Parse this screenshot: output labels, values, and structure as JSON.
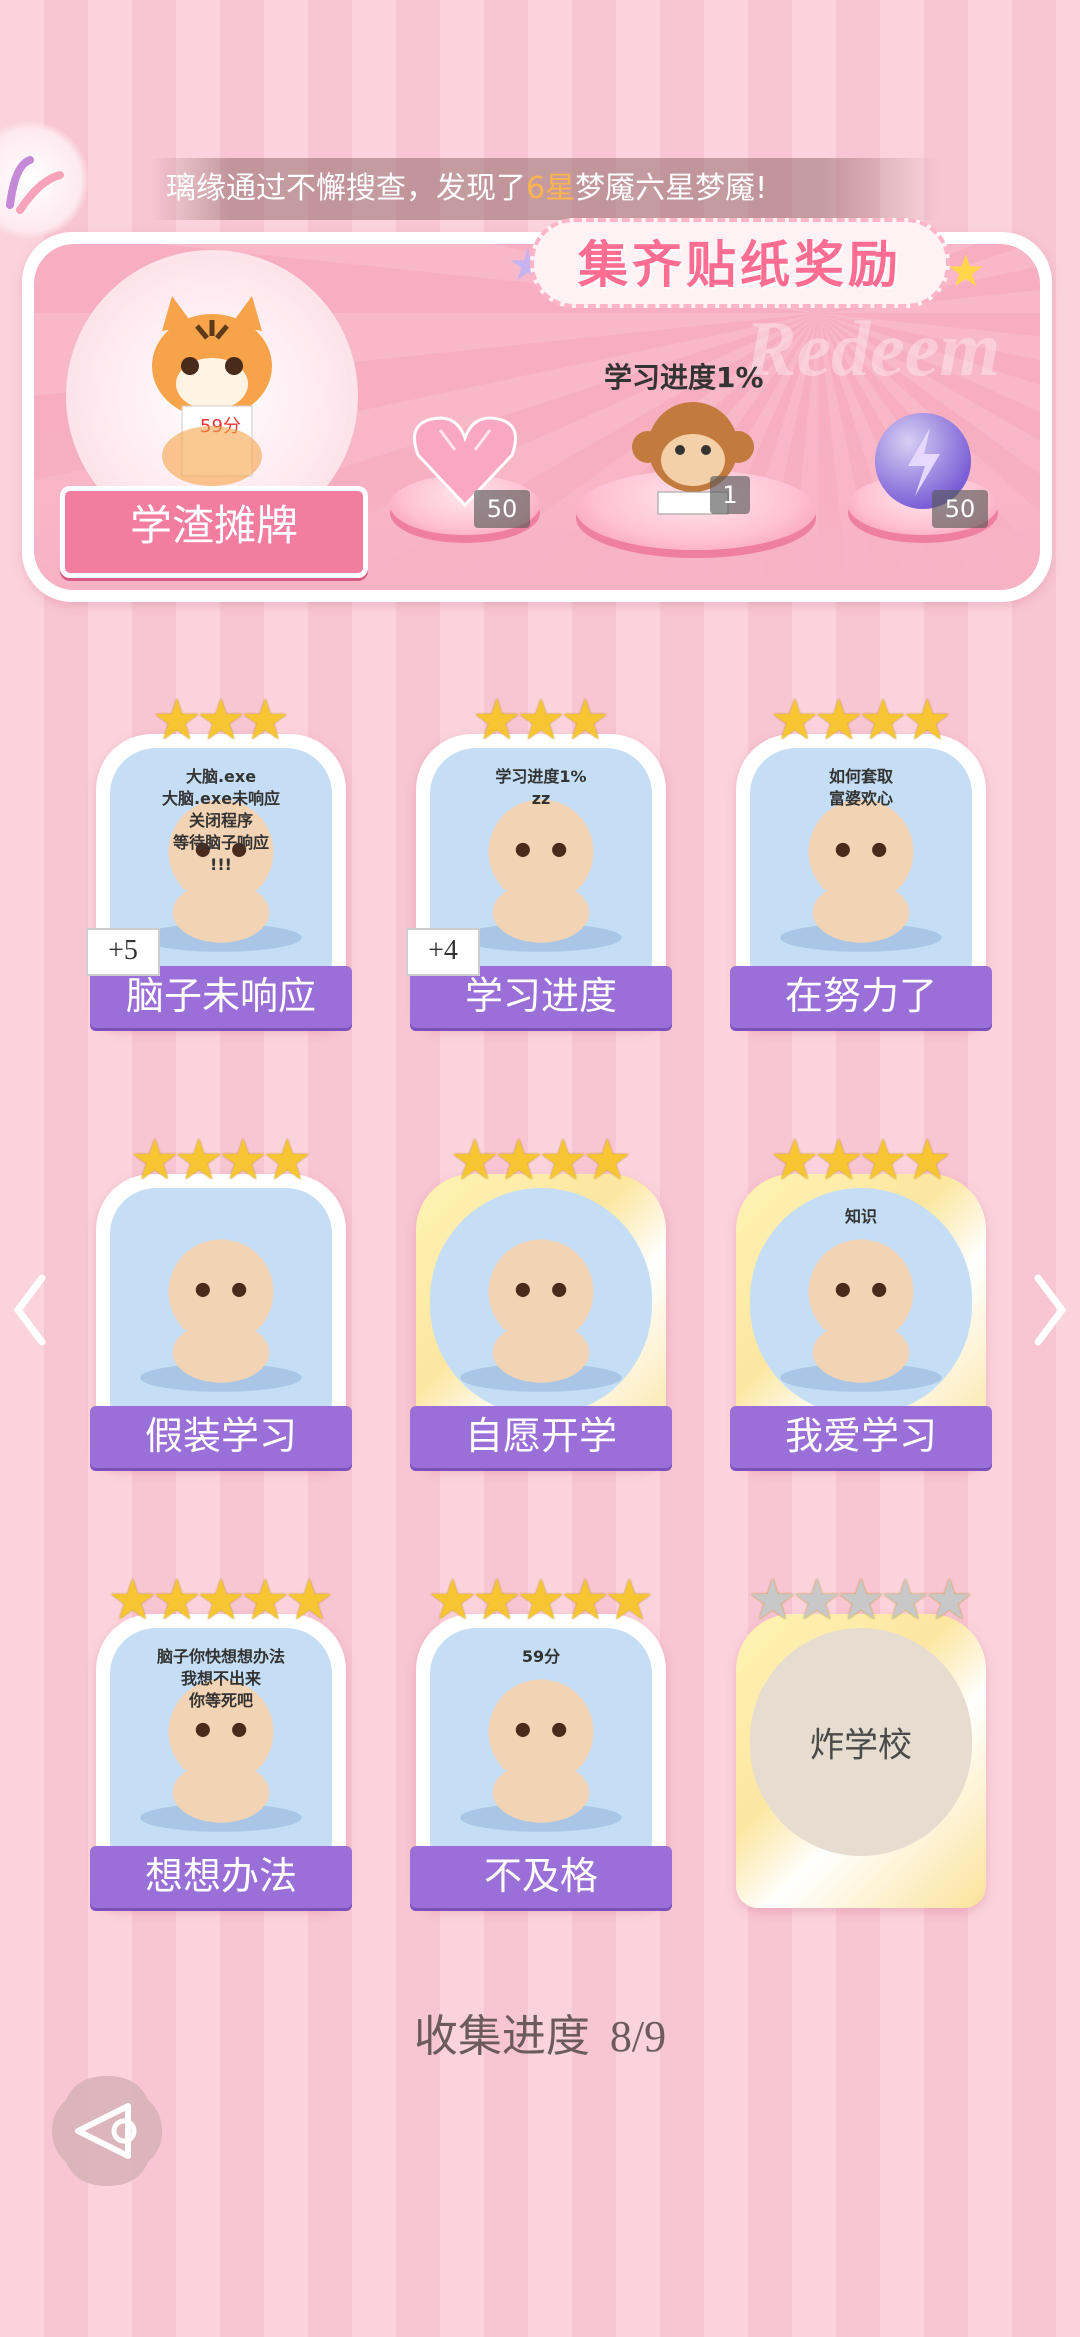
{
  "marquee": {
    "prefix": "璃缘通过不懈搜查，发现了",
    "highlight": "6星",
    "suffix": "梦魇六星梦魇!"
  },
  "reward": {
    "title": "集齐贴纸奖励",
    "watermark": "Redeem",
    "character_name": "学渣摊牌",
    "portrait_score": "59分",
    "items": [
      {
        "icon": "pink-heart-gem-icon",
        "count": "50"
      },
      {
        "icon": "monkey-sticker-icon",
        "count": "1",
        "caption": "学习进度1%"
      },
      {
        "icon": "lightning-orb-icon",
        "count": "50"
      }
    ]
  },
  "cards": [
    {
      "label": "脑子未响应",
      "stars": 3,
      "plus": "+5",
      "gold": false,
      "art_text": [
        "大脑.exe",
        "大脑.exe未响应",
        "关闭程序",
        "等待脑子响应",
        "!!!"
      ]
    },
    {
      "label": "学习进度",
      "stars": 3,
      "plus": "+4",
      "gold": false,
      "art_text": [
        "学习进度1%",
        "zz"
      ]
    },
    {
      "label": "在努力了",
      "stars": 4,
      "plus": "",
      "gold": false,
      "art_text": [
        "如何套取",
        "富婆欢心"
      ]
    },
    {
      "label": "假装学习",
      "stars": 4,
      "plus": "",
      "gold": false,
      "art_text": []
    },
    {
      "label": "自愿开学",
      "stars": 4,
      "plus": "",
      "gold": true,
      "art_text": []
    },
    {
      "label": "我爱学习",
      "stars": 4,
      "plus": "",
      "gold": true,
      "art_text": [
        "知识"
      ]
    },
    {
      "label": "想想办法",
      "stars": 5,
      "plus": "",
      "gold": false,
      "art_text": [
        "脑子你快想想办法",
        "我想不出来",
        "你等死吧"
      ]
    },
    {
      "label": "不及格",
      "stars": 5,
      "plus": "",
      "gold": false,
      "art_text": [
        "59分"
      ]
    },
    {
      "label": "炸学校",
      "stars": 5,
      "plus": "",
      "gold": true,
      "locked": true,
      "art_text": []
    }
  ],
  "progress": {
    "label": "收集进度",
    "value": "8/9"
  },
  "colors": {
    "accent": "#9b6fd8",
    "pink": "#f27d9f",
    "star": "#f6c531"
  }
}
